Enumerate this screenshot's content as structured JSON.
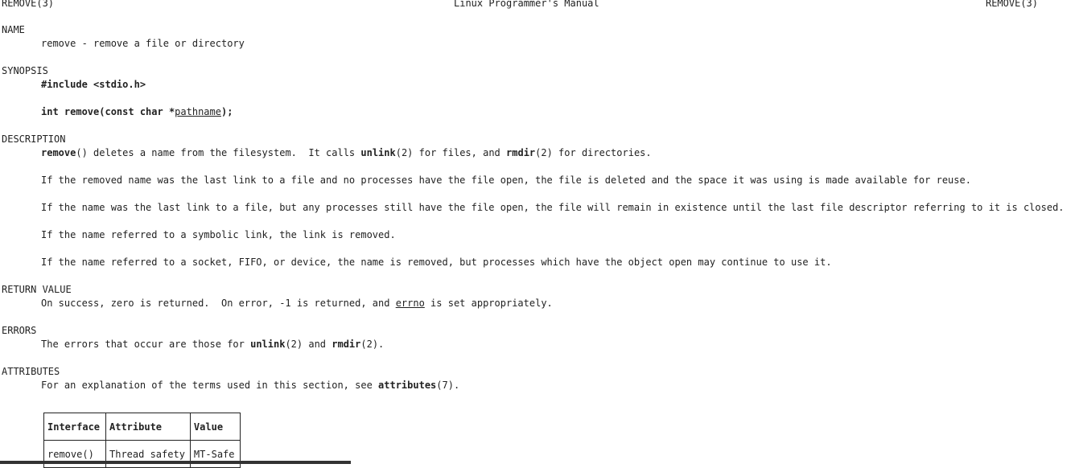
{
  "header": {
    "left": "REMOVE(3)",
    "center": "Linux Programmer's Manual",
    "right": "REMOVE(3)"
  },
  "sections": {
    "name": {
      "title": "NAME",
      "text": "remove - remove a file or directory"
    },
    "synopsis": {
      "title": "SYNOPSIS",
      "include": "#include <stdio.h>",
      "proto_pre": "int remove(const char *",
      "proto_arg": "pathname",
      "proto_post": ");"
    },
    "description": {
      "title": "DESCRIPTION",
      "p1_fn": "remove",
      "p1_a": "() deletes a name from the filesystem.  It calls ",
      "p1_unlink": "unlink",
      "p1_b": "(2) for files, and ",
      "p1_rmdir": "rmdir",
      "p1_c": "(2) for directories.",
      "p2": "If the removed name was the last link to a file and no processes have the file open, the file is deleted and the space it was using is made available for reuse.",
      "p3": "If the name was the last link to a file, but any processes still have the file open, the file will remain in existence until the last file descriptor referring to it is closed.",
      "p4": "If the name referred to a symbolic link, the link is removed.",
      "p5": "If the name referred to a socket, FIFO, or device, the name is removed, but processes which have the object open may continue to use it."
    },
    "return_value": {
      "title": "RETURN VALUE",
      "a": "On success, zero is returned.  On error, -1 is returned, and ",
      "errno": "errno",
      "b": " is set appropriately."
    },
    "errors": {
      "title": "ERRORS",
      "a": "The errors that occur are those for ",
      "unlink": "unlink",
      "b": "(2) and ",
      "rmdir": "rmdir",
      "c": "(2)."
    },
    "attributes": {
      "title": "ATTRIBUTES",
      "a": "For an explanation of the terms used in this section, see ",
      "ref": "attributes",
      "b": "(7).",
      "table": {
        "headers": [
          "Interface",
          "Attribute",
          "Value"
        ],
        "rows": [
          [
            "remove()",
            "Thread safety",
            "MT-Safe"
          ]
        ]
      }
    }
  }
}
